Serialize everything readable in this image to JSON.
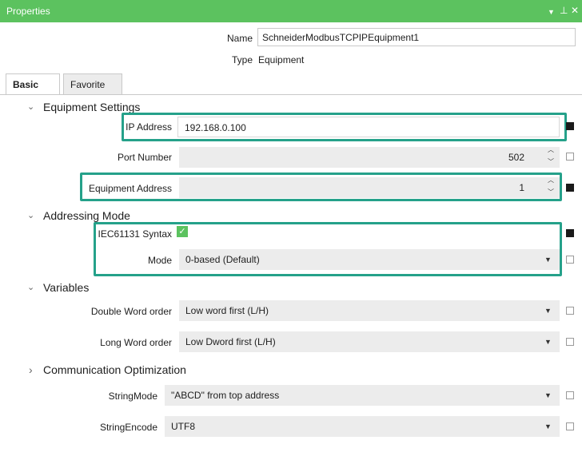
{
  "window": {
    "title": "Properties",
    "dropdown_glyph": "▼",
    "pin_glyph": "⊥",
    "close_glyph": "✕"
  },
  "header": {
    "name_label": "Name",
    "name_value": "SchneiderModbusTCPIPEquipment1",
    "type_label": "Type",
    "type_value": "Equipment"
  },
  "tabs": [
    {
      "label": "Basic",
      "active": true
    },
    {
      "label": "Favorite",
      "active": false
    }
  ],
  "sections": {
    "equipment": {
      "title": "Equipment Settings",
      "expanded": true,
      "ip_label": "IP Address",
      "ip_value": "192.168.0.100",
      "port_label": "Port Number",
      "port_value": "502",
      "addr_label": "Equipment Address",
      "addr_value": "1"
    },
    "addressing": {
      "title": "Addressing Mode",
      "expanded": true,
      "iec_label": "IEC61131 Syntax",
      "iec_checked": true,
      "mode_label": "Mode",
      "mode_value": "0-based (Default)"
    },
    "variables": {
      "title": "Variables",
      "expanded": true,
      "dword_label": "Double Word order",
      "dword_value": "Low word first (L/H)",
      "lword_label": "Long Word order",
      "lword_value": "Low Dword first (L/H)"
    },
    "comm": {
      "title": "Communication Optimization",
      "expanded": false,
      "smode_label": "StringMode",
      "smode_value": "\"ABCD\" from top address",
      "senc_label": "StringEncode",
      "senc_value": "UTF8"
    }
  },
  "icons": {
    "expanded": "⌄",
    "collapsed": "›",
    "spin_up": "︿",
    "spin_down": "﹀",
    "dropdown": "▼",
    "check": "✓"
  },
  "colors": {
    "accent": "#5cc25f",
    "highlight": "#25a18a"
  }
}
